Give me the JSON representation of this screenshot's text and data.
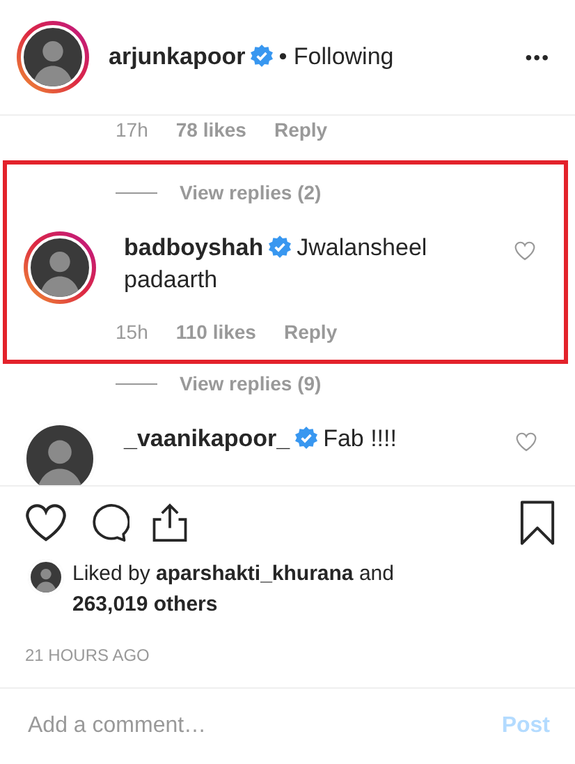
{
  "header": {
    "user": "arjunkapoor",
    "verified": true,
    "follow_status": "• Following",
    "more": "•••"
  },
  "items": [
    {
      "kind": "meta",
      "time": "17h",
      "likes": "78 likes",
      "reply": "Reply",
      "highlighted": false
    },
    {
      "kind": "replies",
      "label": "View replies (2)",
      "highlighted": true
    },
    {
      "kind": "comment",
      "user": "badboyshah",
      "verified": true,
      "text": "Jwalansheel padaarth",
      "time": "15h",
      "likes": "110 likes",
      "reply": "Reply",
      "highlighted": true
    },
    {
      "kind": "replies",
      "label": "View replies (9)",
      "highlighted": false
    },
    {
      "kind": "comment",
      "user": "_vaanikapoor_",
      "verified": true,
      "text": "Fab !!!!",
      "highlighted": false
    }
  ],
  "likes": {
    "prefix": "Liked by ",
    "user": "aparshakti_khurana",
    "middle": " and ",
    "count": "263,019 others"
  },
  "timestamp": "21 HOURS AGO",
  "comment_box": {
    "placeholder": "Add a comment…",
    "button": "Post",
    "disabled": true
  }
}
